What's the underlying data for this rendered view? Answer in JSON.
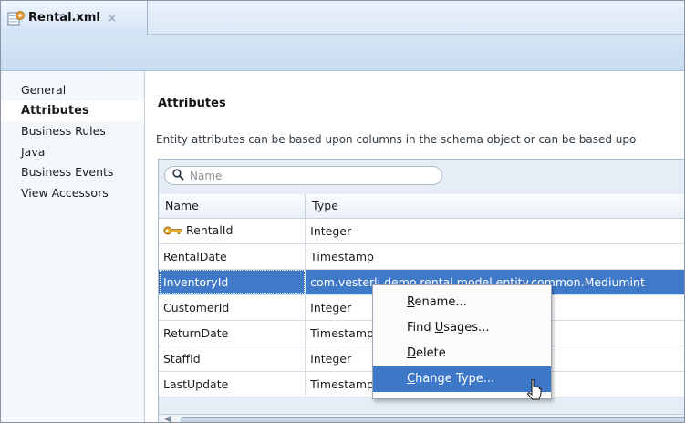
{
  "editor_tab": {
    "title": "Rental.xml",
    "close_glyph": "×",
    "icon": "xml-entity-file-icon"
  },
  "sidebar": {
    "items": [
      {
        "label": "General",
        "active": false
      },
      {
        "label": "Attributes",
        "active": true
      },
      {
        "label": "Business Rules",
        "active": false
      },
      {
        "label": "Java",
        "active": false
      },
      {
        "label": "Business Events",
        "active": false
      },
      {
        "label": "View Accessors",
        "active": false
      }
    ]
  },
  "main": {
    "title": "Attributes",
    "description": "Entity attributes can be based upon columns in the schema object or can be based upo",
    "search": {
      "placeholder": "Name",
      "value": "",
      "icon": "search-icon"
    }
  },
  "table": {
    "columns": [
      "Name",
      "Type"
    ],
    "rows": [
      {
        "name": "RentalId",
        "type": "Integer",
        "key": true,
        "selected": false
      },
      {
        "name": "RentalDate",
        "type": "Timestamp",
        "key": false,
        "selected": false
      },
      {
        "name": "InventoryId",
        "type": "com.vesterli.demo.rental.model.entity.common.Mediumint",
        "key": false,
        "selected": true
      },
      {
        "name": "CustomerId",
        "type": "Integer",
        "key": false,
        "selected": false
      },
      {
        "name": "ReturnDate",
        "type": "Timestamp",
        "key": false,
        "selected": false
      },
      {
        "name": "StaffId",
        "type": "Integer",
        "key": false,
        "selected": false
      },
      {
        "name": "LastUpdate",
        "type": "Timestamp",
        "key": false,
        "selected": false
      }
    ]
  },
  "context_menu": {
    "items": [
      {
        "pre": "",
        "mn": "R",
        "post": "ename...",
        "hover": false
      },
      {
        "pre": "Find ",
        "mn": "U",
        "post": "sages...",
        "hover": false
      },
      {
        "pre": "",
        "mn": "D",
        "post": "elete",
        "hover": false
      },
      {
        "pre": "",
        "mn": "C",
        "post": "hange Type...",
        "hover": true
      }
    ]
  },
  "colors": {
    "selection": "#3f79c8",
    "menu_hover": "#3d78c8",
    "header_band": "#c7dbf0"
  }
}
